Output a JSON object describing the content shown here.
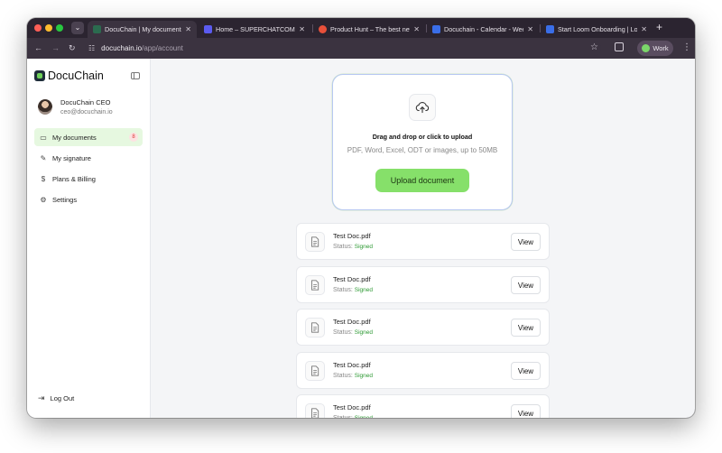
{
  "browser": {
    "tabs": [
      {
        "label": "DocuChain | My documents",
        "favicon_color": "#2b6b4f",
        "active": true
      },
      {
        "label": "Home – SUPERCHATCOMPANY",
        "favicon_color": "#5b5bf0",
        "active": false
      },
      {
        "label": "Product Hunt – The best new",
        "favicon_color": "#e8503a",
        "active": false
      },
      {
        "label": "Docuchain - Calendar - Week",
        "favicon_color": "#3a6ee8",
        "active": false
      },
      {
        "label": "Start Loom Onboarding | Loom",
        "favicon_color": "#3a6ee8",
        "active": false
      }
    ],
    "close_glyph": "✕",
    "new_tab_glyph": "+",
    "url_host": "docuchain.io",
    "url_path": "/app/account",
    "profile_label": "Work"
  },
  "sidebar": {
    "brand": "DocuChain",
    "user": {
      "name": "DocuChain CEO",
      "email": "ceo@docuchain.io"
    },
    "items": [
      {
        "label": "My documents",
        "icon": "document-icon",
        "glyph": "▭",
        "badge": "8",
        "active": true
      },
      {
        "label": "My signature",
        "icon": "signature-icon",
        "glyph": "✎",
        "active": false
      },
      {
        "label": "Plans & Billing",
        "icon": "dollar-icon",
        "glyph": "$",
        "active": false
      },
      {
        "label": "Settings",
        "icon": "gear-icon",
        "glyph": "⚙",
        "active": false
      }
    ],
    "logout_label": "Log Out"
  },
  "upload": {
    "title": "Drag and drop or click to upload",
    "subtitle": "PDF, Word, Excel, ODT or images, up to 50MB",
    "button_label": "Upload document"
  },
  "documents": [
    {
      "name": "Test Doc.pdf",
      "status_label": "Status:",
      "status": "Signed",
      "action": "View"
    },
    {
      "name": "Test Doc.pdf",
      "status_label": "Status:",
      "status": "Signed",
      "action": "View"
    },
    {
      "name": "Test Doc.pdf",
      "status_label": "Status:",
      "status": "Signed",
      "action": "View"
    },
    {
      "name": "Test Doc.pdf",
      "status_label": "Status:",
      "status": "Signed",
      "action": "View"
    },
    {
      "name": "Test Doc.pdf",
      "status_label": "Status:",
      "status": "Signed",
      "action": "View"
    }
  ],
  "colors": {
    "accent_green": "#86e06a",
    "status_green": "#2e9a34",
    "badge_red": "#d33"
  }
}
